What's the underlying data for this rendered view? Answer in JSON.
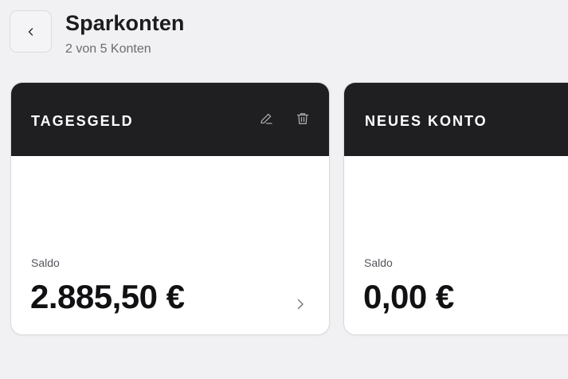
{
  "header": {
    "back_icon": "chevron-left-icon",
    "title": "Sparkonten",
    "subtitle": "2 von 5 Konten"
  },
  "accounts": [
    {
      "name": "TAGESGELD",
      "saldo_label": "Saldo",
      "saldo": "2.885,50 €",
      "actions": [
        "pencil-icon",
        "trash-icon"
      ],
      "open_icon": "chevron-right-icon"
    },
    {
      "name": "NEUES KONTO",
      "saldo_label": "Saldo",
      "saldo": "0,00 €"
    }
  ],
  "colors": {
    "background": "#f1f1f3",
    "card_header": "#1f1f22",
    "card_body": "#ffffff",
    "text_primary": "#111114",
    "text_secondary": "#6b6b72"
  }
}
